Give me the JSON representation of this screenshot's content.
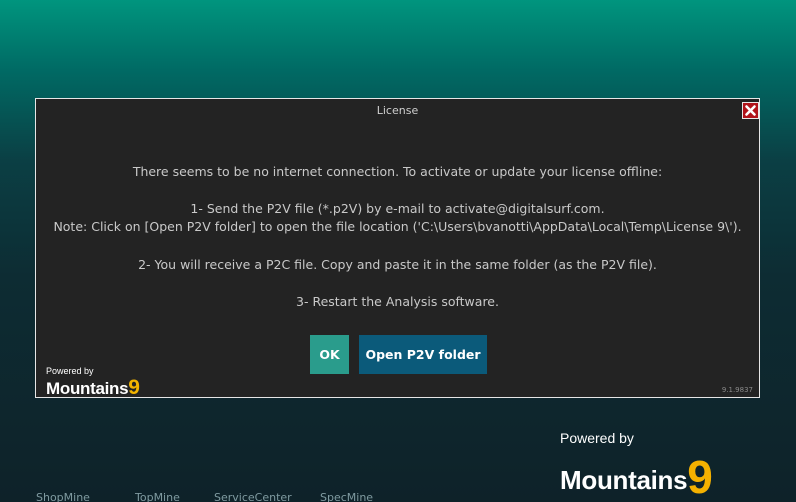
{
  "dialog": {
    "title": "License",
    "messages": {
      "intro": "There seems to be no internet connection. To activate or update your license offline:",
      "step1": "1- Send the P2V file (*.p2V) by e-mail to activate@digitalsurf.com.",
      "note": "Note: Click on [Open P2V folder] to open the file location ('C:\\Users\\bvanotti\\AppData\\Local\\Temp\\License 9\\').",
      "step2": "2- You will receive a P2C file. Copy and paste it in the same folder (as the P2V file).",
      "step3": "3- Restart the Analysis software."
    },
    "buttons": {
      "ok": "OK",
      "open_folder": "Open P2V folder"
    },
    "version": "9.1.9837",
    "logo": {
      "powered_by": "Powered by",
      "brand": "Mountains",
      "version_digit": "9"
    }
  },
  "background_logo": {
    "powered_by": "Powered by",
    "brand": "Mountains",
    "version_digit": "9"
  },
  "taskbar": {
    "labels": [
      "ShopMine",
      "TopMine",
      "ServiceCenter",
      "SpecMine"
    ]
  },
  "colors": {
    "dialog_bg": "#232323",
    "ok_button": "#2a9c8c",
    "open_button": "#0b5a7a",
    "close_button": "#b0131a",
    "logo_accent": "#f2b400"
  },
  "icons": {
    "close": "close-icon"
  }
}
